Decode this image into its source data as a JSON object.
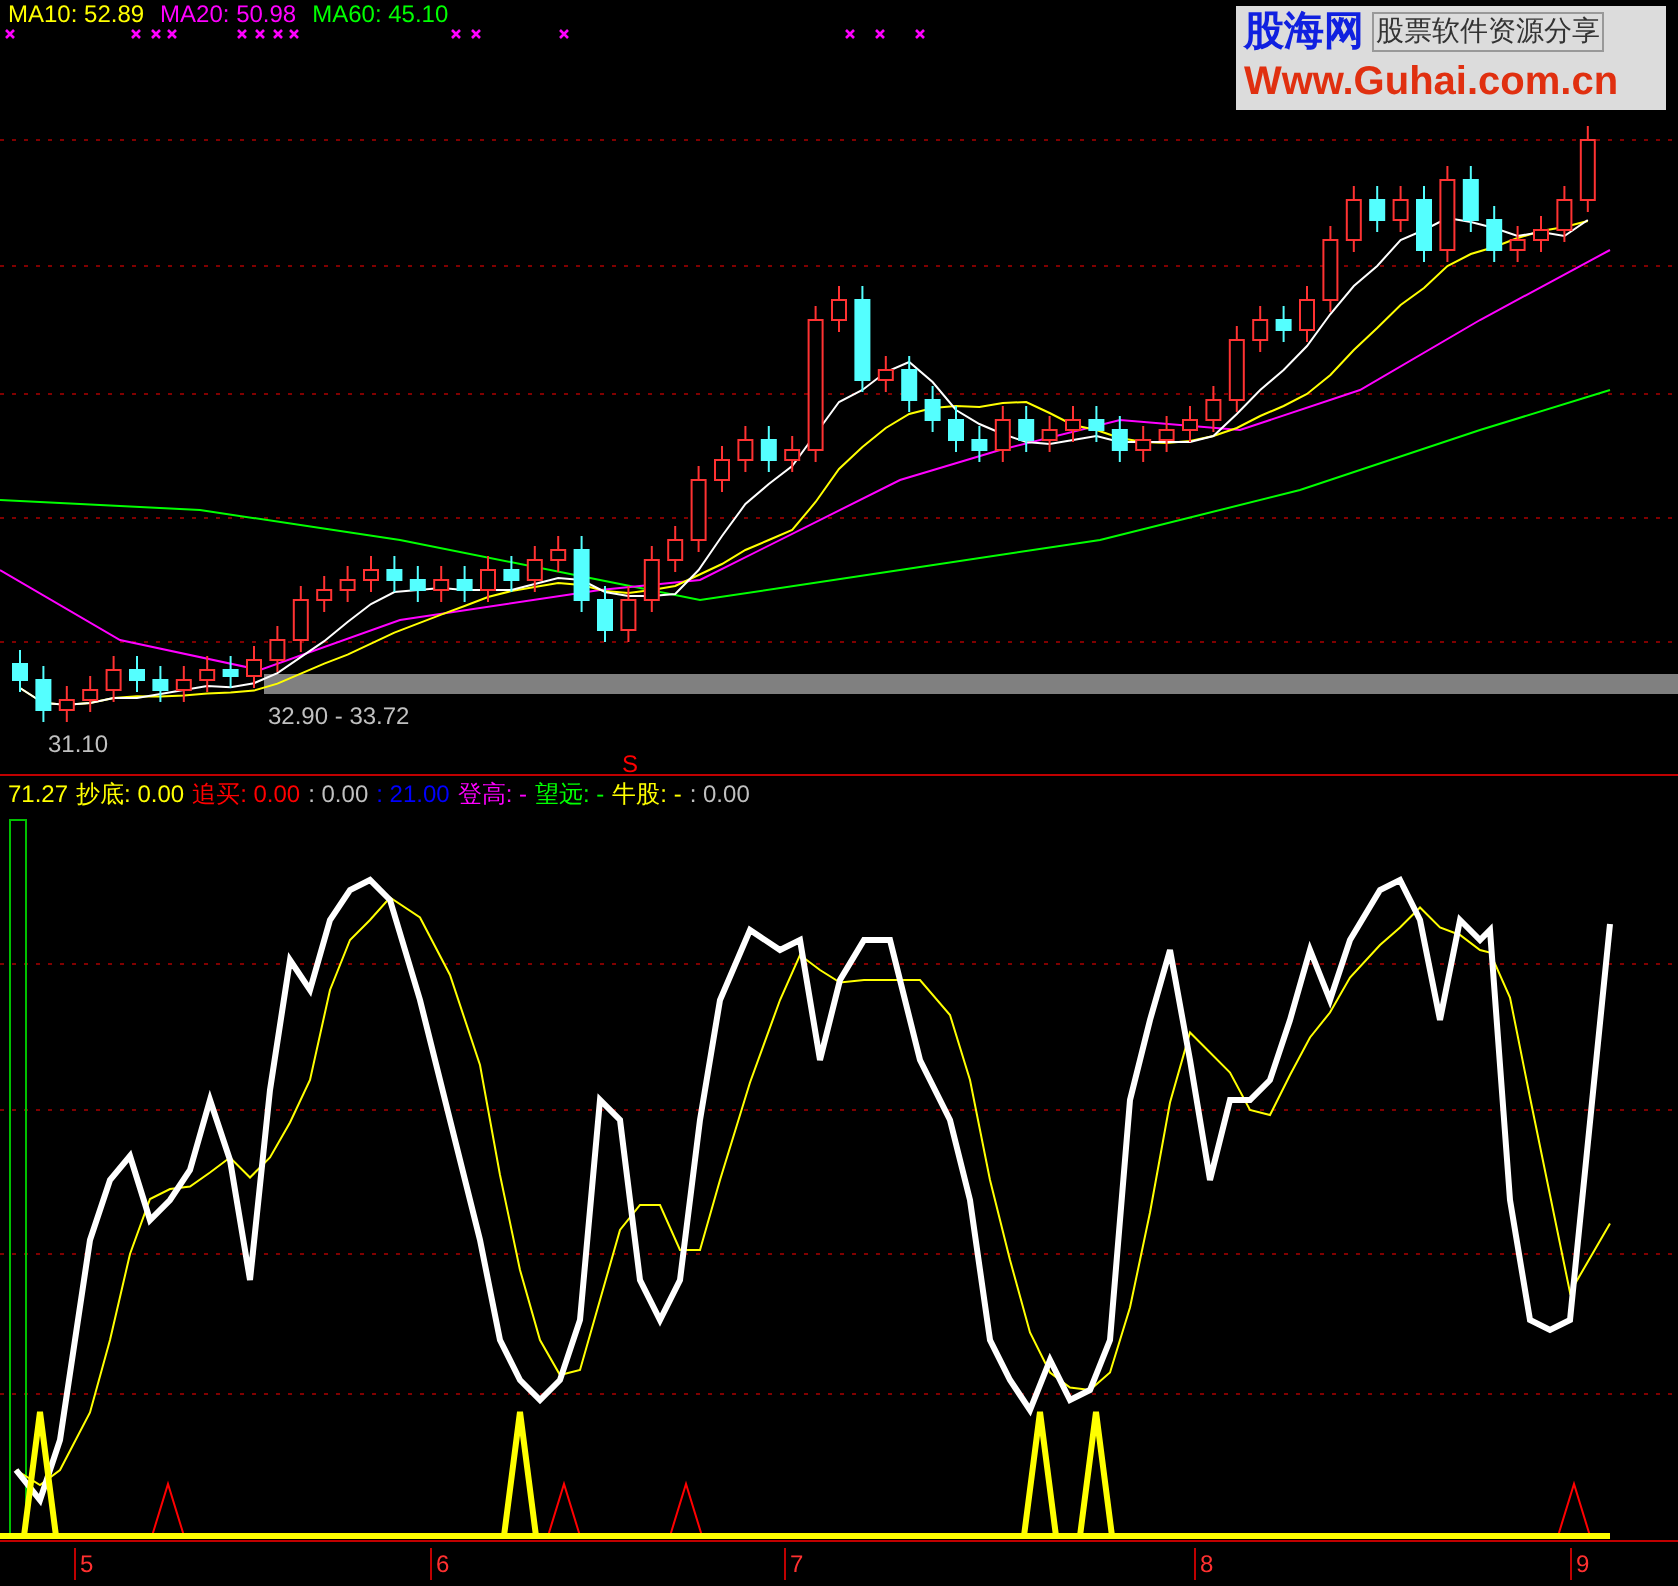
{
  "ma_legend": [
    {
      "label": "MA10: 52.89",
      "color": "#ffff00"
    },
    {
      "label": "MA20: 50.98",
      "color": "#ff00ff"
    },
    {
      "label": "MA60: 45.10",
      "color": "#00ff00"
    }
  ],
  "logo": {
    "name": "股海网",
    "slogan": "股票软件资源分享",
    "url": "Www.Guhai.com.cn"
  },
  "price_labels": {
    "low": "31.10",
    "band": "32.90 - 33.72"
  },
  "signal_mark": "S",
  "indicator_legend": [
    {
      "label": "71.27",
      "color": "#ffff00"
    },
    {
      "label": "抄底: 0.00",
      "color": "#ffff00"
    },
    {
      "label": "追买: 0.00",
      "color": "#ff0000"
    },
    {
      "label": ": 0.00",
      "color": "#c0c0c0"
    },
    {
      "label": ": 21.00",
      "color": "#0000ff"
    },
    {
      "label": "登高: -",
      "color": "#ff00ff"
    },
    {
      "label": "望远: -",
      "color": "#00ff00"
    },
    {
      "label": "牛股: -",
      "color": "#ffff00"
    },
    {
      "label": ": 0.00",
      "color": "#c0c0c0"
    }
  ],
  "time_axis": [
    "5",
    "6",
    "7",
    "8",
    "9"
  ]
}
